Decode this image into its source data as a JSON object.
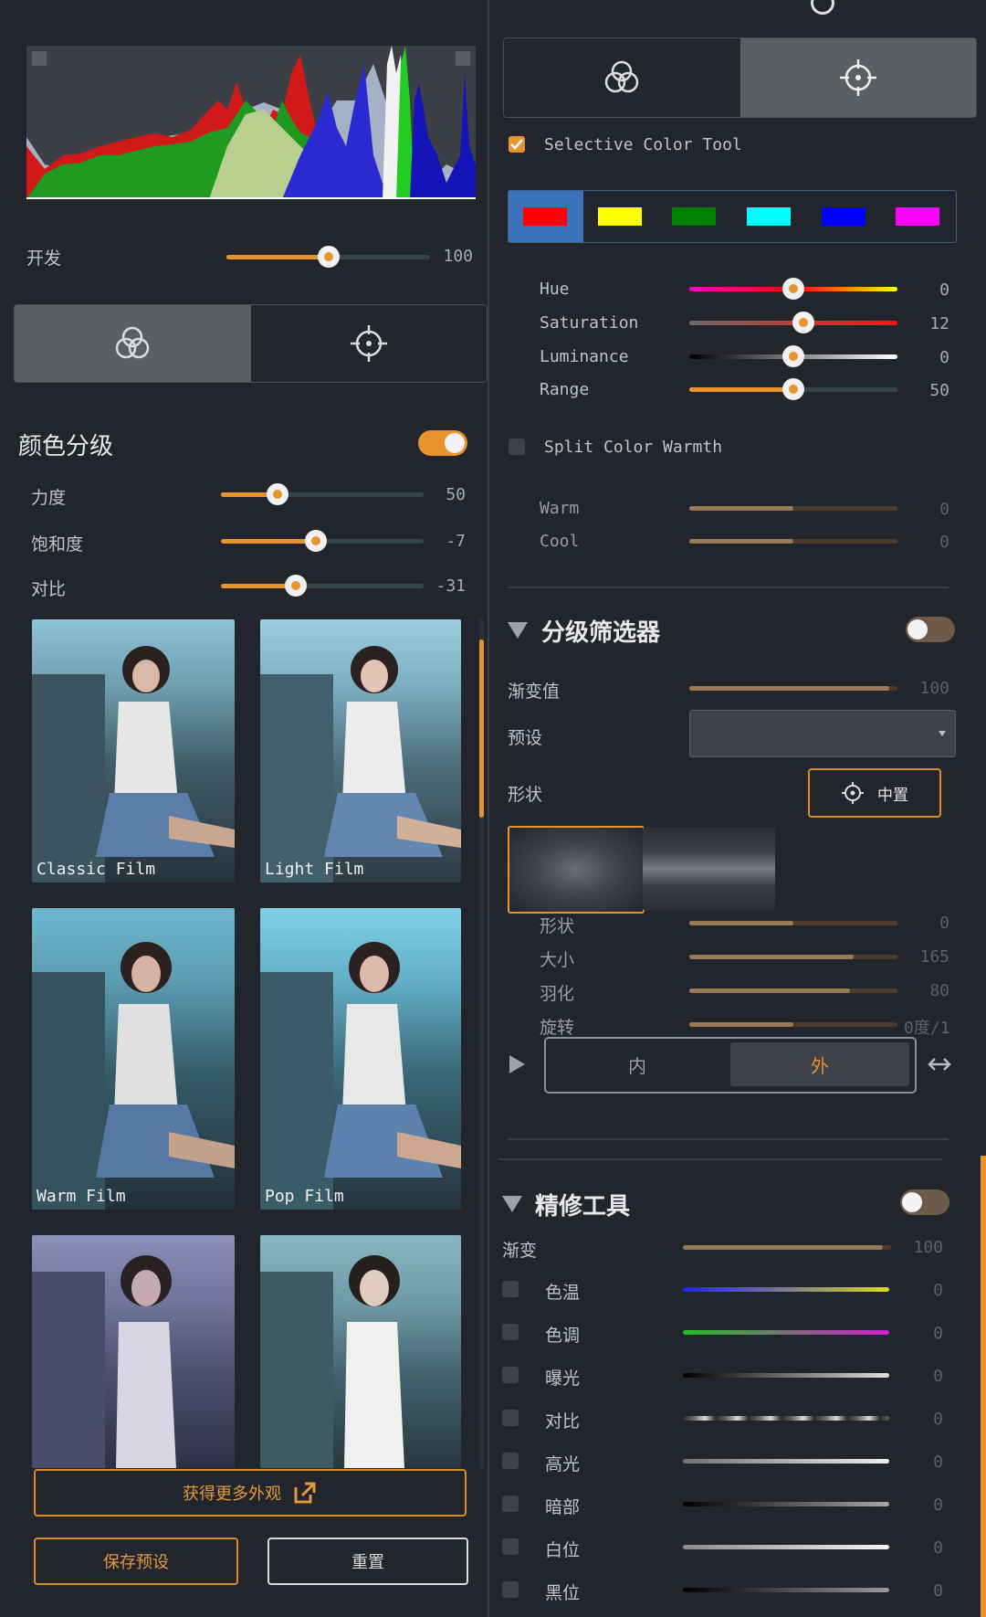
{
  "left": {
    "histogram": {
      "label": "histogram"
    },
    "develop": {
      "label": "开发",
      "value": "100",
      "level": 0.5
    },
    "mode_tabs": {
      "color_icon": "color-rings-icon",
      "target_icon": "crosshair-icon",
      "active": "color"
    },
    "color_grading": {
      "title": "颜色分级",
      "enabled": true,
      "sliders": [
        {
          "label": "力度",
          "value": "50",
          "level": 0.28
        },
        {
          "label": "饱和度",
          "value": "-7",
          "level": 0.47
        },
        {
          "label": "对比",
          "value": "-31",
          "level": 0.37
        }
      ]
    },
    "presets": [
      {
        "name": "Classic Film"
      },
      {
        "name": "Light Film"
      },
      {
        "name": "Warm Film"
      },
      {
        "name": "Pop Film"
      },
      {
        "name": ""
      },
      {
        "name": ""
      }
    ],
    "get_more_label": "获得更多外观",
    "save_preset_label": "保存预设",
    "reset_label": "重置"
  },
  "right": {
    "mode_tabs": {
      "color_icon": "color-rings-icon",
      "target_icon": "crosshair-icon",
      "active": "target"
    },
    "selective_color": {
      "label": "Selective Color Tool",
      "checked": true,
      "swatches": [
        "#ff0000",
        "#ffff00",
        "#008000",
        "#00ffff",
        "#0000ff",
        "#ff00ff"
      ],
      "selected_swatch": 0,
      "sliders": [
        {
          "label": "Hue",
          "value": "0",
          "level": 0.5
        },
        {
          "label": "Saturation",
          "value": "12",
          "level": 0.55
        },
        {
          "label": "Luminance",
          "value": "0",
          "level": 0.5
        },
        {
          "label": "Range",
          "value": "50",
          "level": 0.5
        }
      ]
    },
    "split_warmth": {
      "label": "Split Color Warmth",
      "checked": false,
      "sliders": [
        {
          "label": "Warm",
          "value": "0",
          "level": 0.5
        },
        {
          "label": "Cool",
          "value": "0",
          "level": 0.5
        }
      ]
    },
    "graded_filter": {
      "title": "分级筛选器",
      "enabled": false,
      "gradient_label": "渐变值",
      "gradient_value": "100",
      "preset_label": "预设",
      "preset_value": "",
      "shape_label": "形状",
      "center_label": "中置",
      "shape_sliders": [
        {
          "label": "形状",
          "value": "0",
          "level": 0.5
        },
        {
          "label": "大小",
          "value": "165",
          "level": 0.79
        },
        {
          "label": "羽化",
          "value": "80",
          "level": 0.77
        },
        {
          "label": "旋转",
          "value": "0度/1",
          "level": 0.5
        }
      ],
      "inner_label": "内",
      "outer_label": "外"
    },
    "retouch": {
      "title": "精修工具",
      "enabled": false,
      "gradient_label": "渐变",
      "gradient_value": "100",
      "items": [
        {
          "label": "色温",
          "value": "0"
        },
        {
          "label": "色调",
          "value": "0"
        },
        {
          "label": "曝光",
          "value": "0"
        },
        {
          "label": "对比",
          "value": "0"
        },
        {
          "label": "高光",
          "value": "0"
        },
        {
          "label": "暗部",
          "value": "0"
        },
        {
          "label": "白位",
          "value": "0"
        },
        {
          "label": "黑位",
          "value": "0"
        }
      ]
    }
  }
}
